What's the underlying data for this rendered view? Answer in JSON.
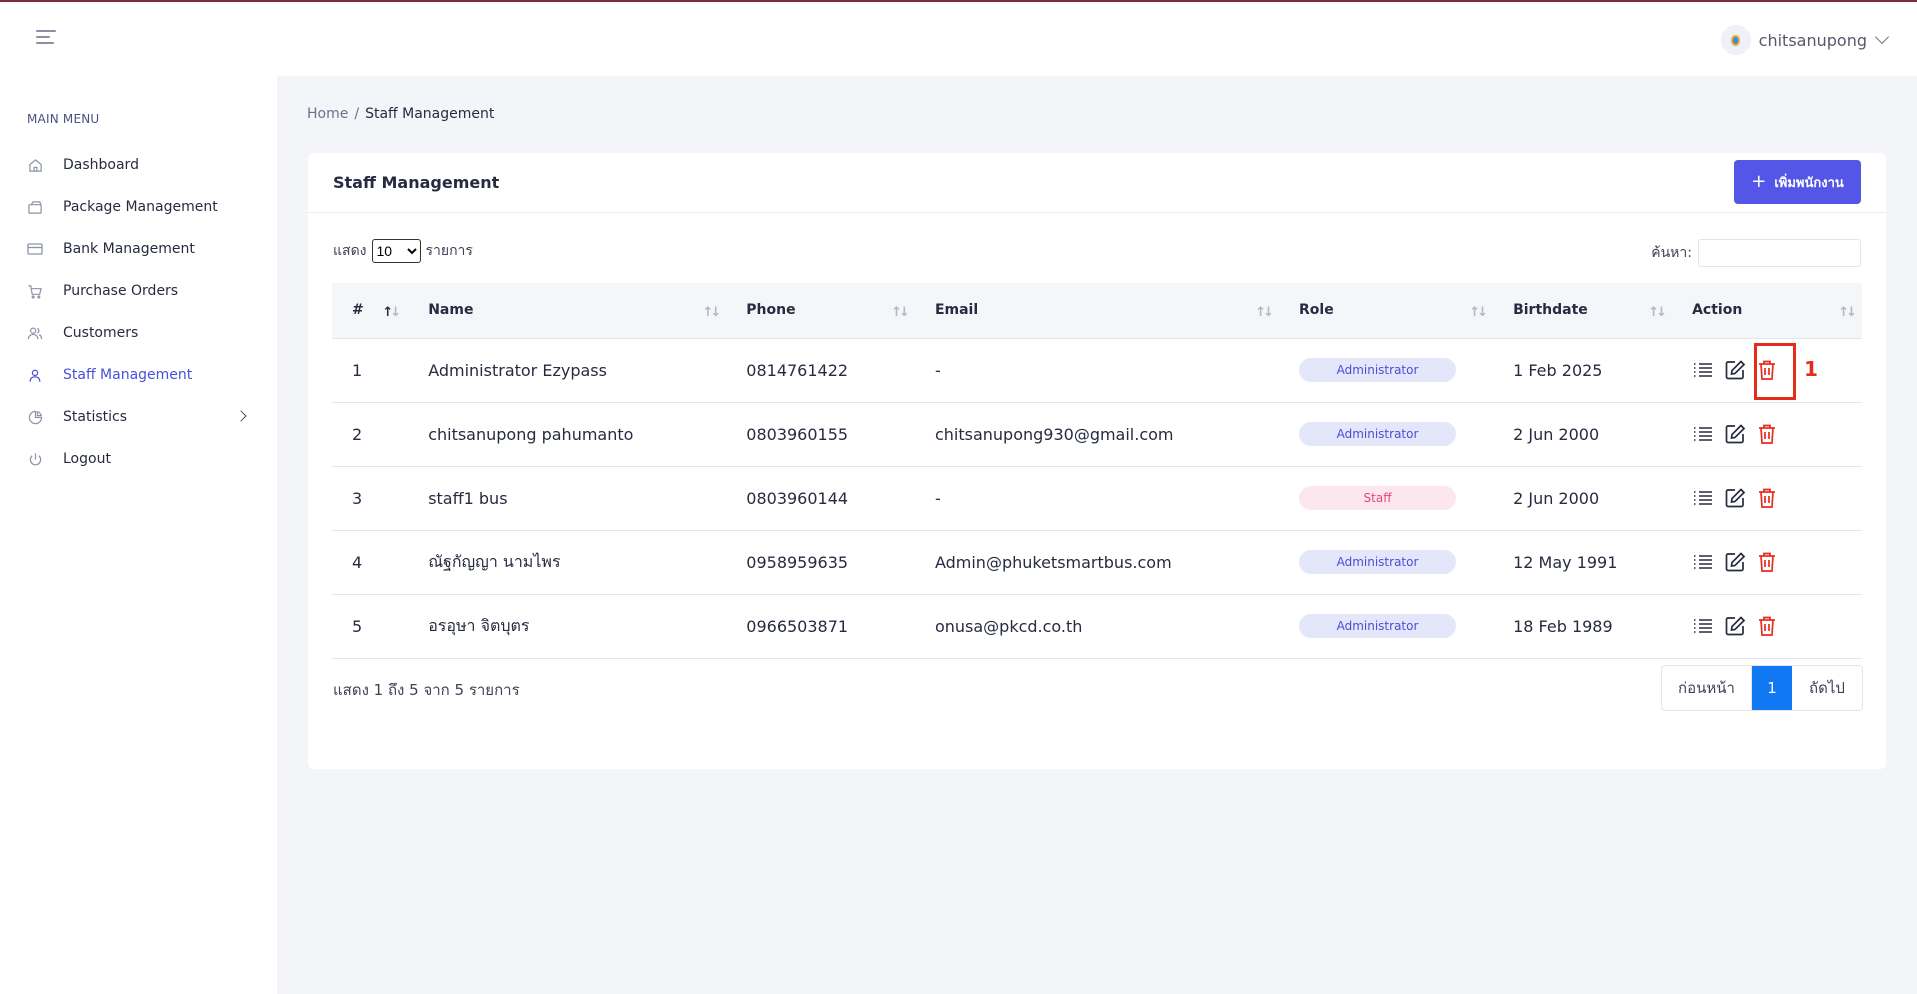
{
  "user": {
    "name": "chitsanupong"
  },
  "sidebar": {
    "title": "MAIN MENU",
    "items": [
      {
        "label": "Dashboard",
        "icon": "home-icon"
      },
      {
        "label": "Package Management",
        "icon": "package-icon"
      },
      {
        "label": "Bank Management",
        "icon": "card-icon"
      },
      {
        "label": "Purchase Orders",
        "icon": "cart-icon"
      },
      {
        "label": "Customers",
        "icon": "users-icon"
      },
      {
        "label": "Staff Management",
        "icon": "user-icon",
        "active": true
      },
      {
        "label": "Statistics",
        "icon": "pie-chart-icon"
      },
      {
        "label": "Logout",
        "icon": "power-icon"
      }
    ]
  },
  "breadcrumb": {
    "home": "Home",
    "separator": "/",
    "current": "Staff Management"
  },
  "card": {
    "title": "Staff Management",
    "add_button": "เพิ่มพนักงาน",
    "show_label": "แสดง",
    "show_value": "10",
    "show_suffix": "รายการ",
    "search_label": "ค้นหา:"
  },
  "table": {
    "headers": [
      "#",
      "Name",
      "Phone",
      "Email",
      "Role",
      "Birthdate",
      "Action"
    ],
    "rows": [
      {
        "no": "1",
        "name": "Administrator Ezypass",
        "phone": "0814761422",
        "email": "-",
        "role": "Administrator",
        "birthdate": "1 Feb 2025"
      },
      {
        "no": "2",
        "name": "chitsanupong pahumanto",
        "phone": "0803960155",
        "email": "chitsanupong930@gmail.com",
        "role": "Administrator",
        "birthdate": "2 Jun 2000"
      },
      {
        "no": "3",
        "name": "staff1 bus",
        "phone": "0803960144",
        "email": "-",
        "role": "Staff",
        "birthdate": "2 Jun 2000"
      },
      {
        "no": "4",
        "name": "ณัฐกัญญา นามไพร",
        "phone": "0958959635",
        "email": "Admin@phuketsmartbus.com",
        "role": "Administrator",
        "birthdate": "12 May 1991"
      },
      {
        "no": "5",
        "name": "อรอุษา จิตบุตร",
        "phone": "0966503871",
        "email": "onusa@pkcd.co.th",
        "role": "Administrator",
        "birthdate": "18 Feb 1989"
      }
    ]
  },
  "annotation": {
    "label": "1"
  },
  "footer": {
    "info": "แสดง 1 ถึง 5 จาก 5 รายการ",
    "prev": "ก่อนหน้า",
    "page": "1",
    "next": "ถัดไป"
  },
  "colors": {
    "accent": "#5356e6",
    "active_menu": "#4a4fd9",
    "danger": "#e32d1c",
    "page_btn": "#1078f2"
  }
}
